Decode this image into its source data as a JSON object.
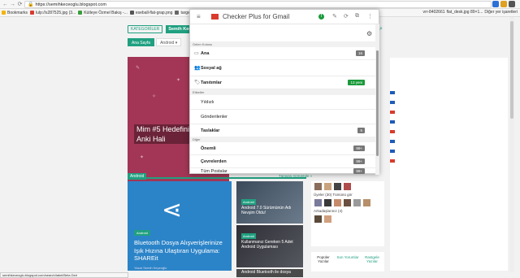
{
  "browser": {
    "url": "https://semihkeceoglu.blogspot.com",
    "extension_icon_colors": [
      "#2c6fd6",
      "#e0a020",
      "#555555"
    ]
  },
  "bookmarks": {
    "items": [
      {
        "label": "Bookmarks",
        "color": "#f4b400"
      },
      {
        "label": "lulp://s287525.jpg (3...",
        "color": "#d83b2d"
      },
      {
        "label": "Kütleye Özmel Bakış -...",
        "color": "#3a9d3a"
      },
      {
        "label": "eseball-flat-grap.png",
        "color": "#555555"
      },
      {
        "label": "target-icon.steps.png",
        "color": "#666666"
      }
    ],
    "right_items": [
      "vrr-8402661",
      "flat_desk.jpg 89×1...",
      "Diğer yer işaretleri"
    ]
  },
  "site": {
    "menu_label": "KATEGORİLER",
    "logo": "Semih Keçeoğlu",
    "tabs": [
      {
        "label": "Ana Sayfa",
        "active": true
      },
      {
        "label": "Android ▾",
        "active": false
      }
    ],
    "hero_title": "Mim #5 Hedefiniz ve Şu Anki Hali",
    "android_tag": "Android",
    "all_link": "Tümünü Görüntüle »",
    "big_card": {
      "badge": "Android",
      "title": "Bluetooth Dosya Alışverişlerinize Işık Hızına Ulaştıran Uygulama: SHAREit",
      "author": "Yazar Semih Keçeoğlu"
    },
    "side_cards": [
      {
        "badge": "Android",
        "title": "Android 7.0 Sürümünün Adı Nevşim Oldu!"
      },
      {
        "badge": "Android",
        "title": "Kullanmanız Gereken 5 Adet Android Uygulaması"
      },
      {
        "badge": "Android",
        "title": "Android Bluetooth ile dosya"
      }
    ],
    "right_col": {
      "lines": [
        "Üyeler (30) Tümünü gör",
        "Arkadaşlarınız (4)"
      ],
      "avatar_colors": [
        "#8a6d5a",
        "#c9a37e",
        "#444444",
        "#b04c4c",
        "#7a7a9a",
        "#3a3a3a",
        "#c48a6a",
        "#6b5040",
        "#9a9a9a",
        "#b78f6a",
        "#5a4a3a",
        "#d0a080"
      ]
    },
    "bottom_tabs": [
      "Popüler Yazılar",
      "Son Yorumlar",
      "Rastgele Yazılar"
    ],
    "flag_colors": [
      "#1f5bb8",
      "#1f5bb8",
      "#d83b2d",
      "#1f5bb8",
      "#d83b2d",
      "#1f5bb8",
      "#1f5bb8",
      "#d83b2d"
    ]
  },
  "popup": {
    "title": "Checker Plus for Gmail",
    "sections": {
      "categories": "Gelen Kutusu",
      "labels": "Etiketler",
      "other": "Diğer"
    },
    "rows": {
      "ana": {
        "label": "Ana",
        "count": "16"
      },
      "sosyal": {
        "label": "Sosyal ağ",
        "count": ""
      },
      "tanitimlar": {
        "label": "Tanıtımlar",
        "count": "13 yeni"
      },
      "yildizli": {
        "label": "Yıldızlı"
      },
      "gonderilenler": {
        "label": "Gönderilenler"
      },
      "taslaklar": {
        "label": "Taslaklar",
        "count": "5"
      },
      "onemli": {
        "label": "Önemli",
        "count": "99+"
      },
      "cevrelerden": {
        "label": "Çevrelerden",
        "count": "99+"
      },
      "tum": {
        "label": "Tüm Postalar",
        "count": "99+"
      }
    }
  },
  "status_bar": "semihkeceoglu.blogspot.com/search/label/Beta Deri"
}
